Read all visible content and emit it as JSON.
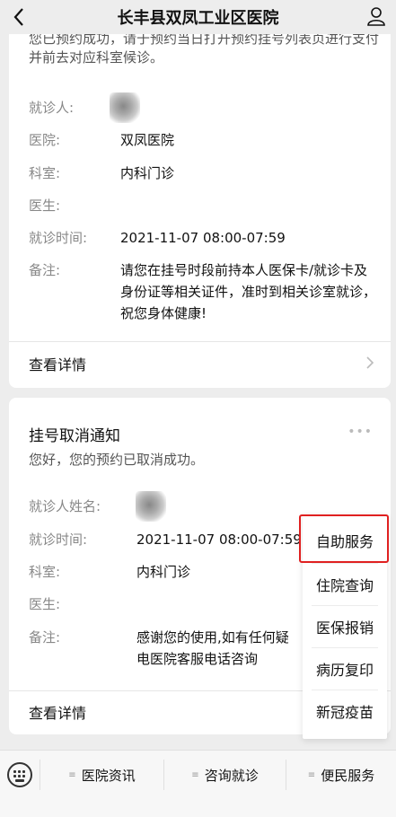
{
  "header": {
    "title": "长丰县双凤工业区医院"
  },
  "card1": {
    "notice": "您已预约成功，请于预约当日打开预约挂号列表页进行支付并前去对应科室候诊。",
    "rows": [
      {
        "label": "就诊人:",
        "value": ""
      },
      {
        "label": "医院:",
        "value": "双凤医院"
      },
      {
        "label": "科室:",
        "value": "内科门诊"
      },
      {
        "label": "医生:",
        "value": ""
      },
      {
        "label": "就诊时间:",
        "value": "2021-11-07 08:00-07:59"
      },
      {
        "label": "备注:",
        "value": "请您在挂号时段前持本人医保卡/就诊卡及身份证等相关证件，准时到相关诊室就诊，祝您身体健康!"
      }
    ],
    "detail": "查看详情"
  },
  "card2": {
    "title": "挂号取消通知",
    "more": "•••",
    "notice": "您好，您的预约已取消成功。",
    "rows": [
      {
        "label": "就诊人姓名:",
        "value": ""
      },
      {
        "label": "就诊时间:",
        "value": "2021-11-07 08:00-07:59"
      },
      {
        "label": "科室:",
        "value": "内科门诊"
      },
      {
        "label": "医生:",
        "value": ""
      },
      {
        "label": "备注:",
        "value": "感谢您的使用,如有任何疑电医院客服电话咨询"
      }
    ],
    "detail": "查看详情"
  },
  "popup": {
    "items": [
      "自助服务",
      "住院查询",
      "医保报销",
      "病历复印",
      "新冠疫苗"
    ],
    "highlight_color": "#e02020"
  },
  "bottombar": {
    "tabs": [
      "医院资讯",
      "咨询就诊",
      "便民服务"
    ],
    "menu_glyph": "≡"
  }
}
